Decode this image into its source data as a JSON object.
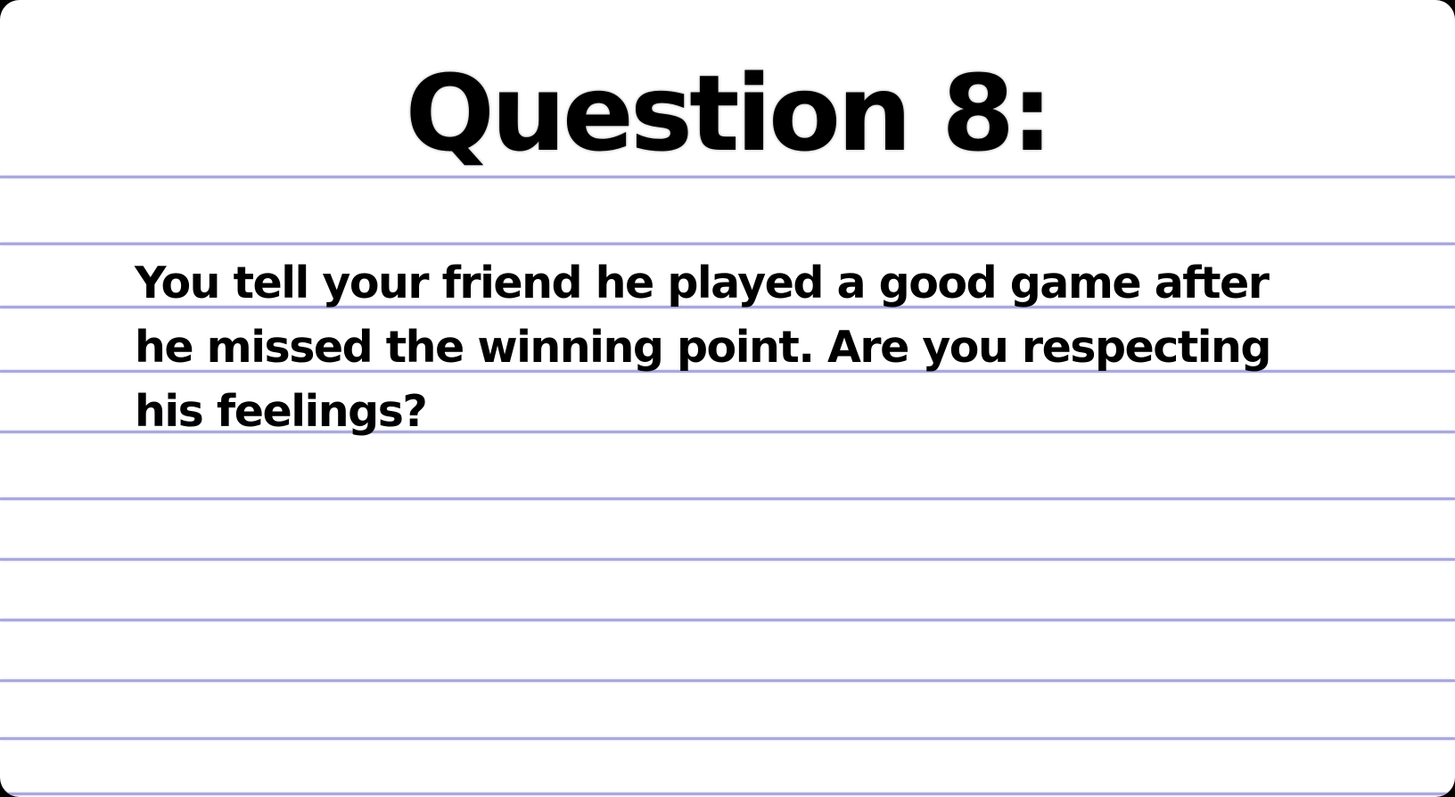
{
  "slide": {
    "title": "Question 8:",
    "question": "You tell your friend he played a good game after he missed the winning point. Are you respecting his feelings?",
    "colors": {
      "background": "#ffffff",
      "rule_lines": "#a9a9dc",
      "text": "#000000"
    }
  }
}
